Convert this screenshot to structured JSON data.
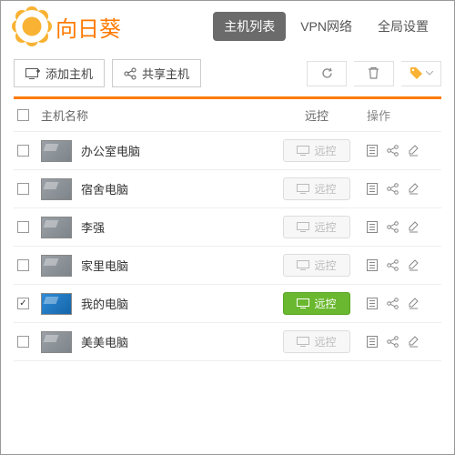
{
  "app": {
    "title": "向日葵"
  },
  "nav": {
    "hosts": "主机列表",
    "vpn": "VPN网络",
    "settings": "全局设置"
  },
  "toolbar": {
    "add_host": "添加主机",
    "share_host": "共享主机"
  },
  "table": {
    "headers": {
      "name": "主机名称",
      "remote": "远控",
      "ops": "操作"
    },
    "remote_label": "远控",
    "rows": [
      {
        "name": "办公室电脑",
        "online": false,
        "checked": false
      },
      {
        "name": "宿舍电脑",
        "online": false,
        "checked": false
      },
      {
        "name": "李强",
        "online": false,
        "checked": false
      },
      {
        "name": "家里电脑",
        "online": false,
        "checked": false
      },
      {
        "name": "我的电脑",
        "online": true,
        "checked": true
      },
      {
        "name": "美美电脑",
        "online": false,
        "checked": false
      }
    ]
  }
}
